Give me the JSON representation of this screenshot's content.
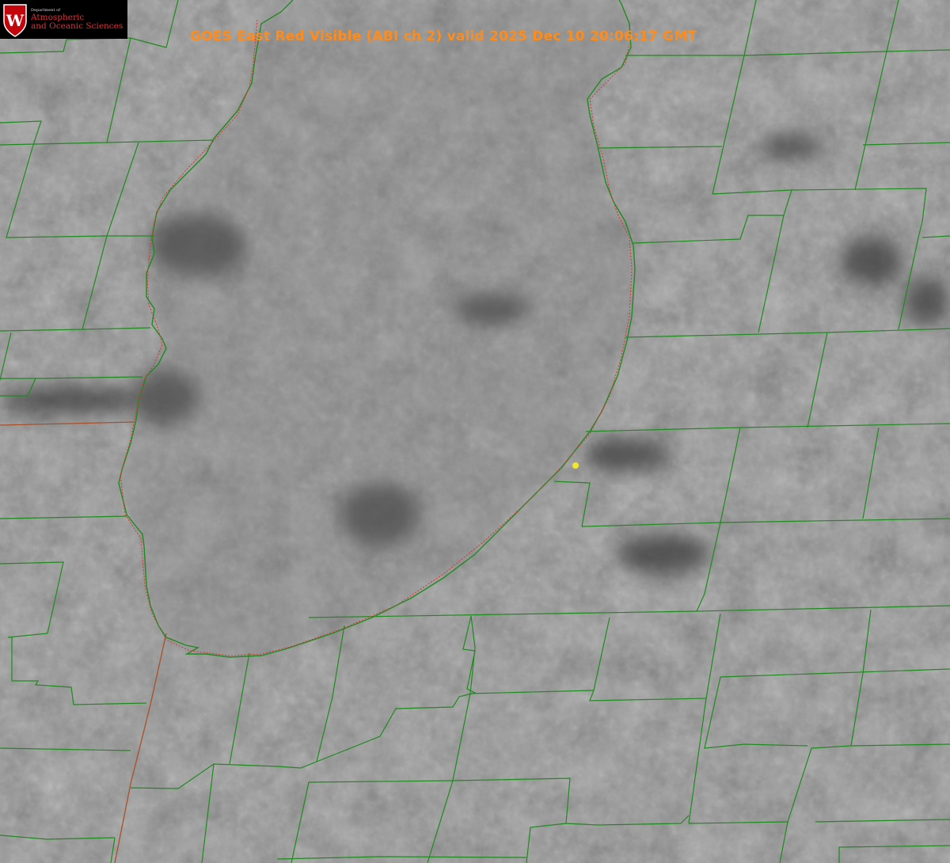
{
  "title": "GOES East Red Visible (ABI ch 2) valid 2025 Dec 10 20:06:17 GMT",
  "logo": {
    "dept": "Department of",
    "line1": "Atmospheric",
    "line2": "and Oceanic Sciences",
    "shield_letter": "W"
  },
  "colors": {
    "title": "#ff8c1a",
    "county_lines": "#1f8a1f",
    "state_lines": "#b04a1a",
    "lake_outline": "#e03030",
    "marker": "#f2e82a",
    "logo_red": "#c5050c"
  },
  "marker": {
    "label": "",
    "icon": "yellow-dot"
  }
}
